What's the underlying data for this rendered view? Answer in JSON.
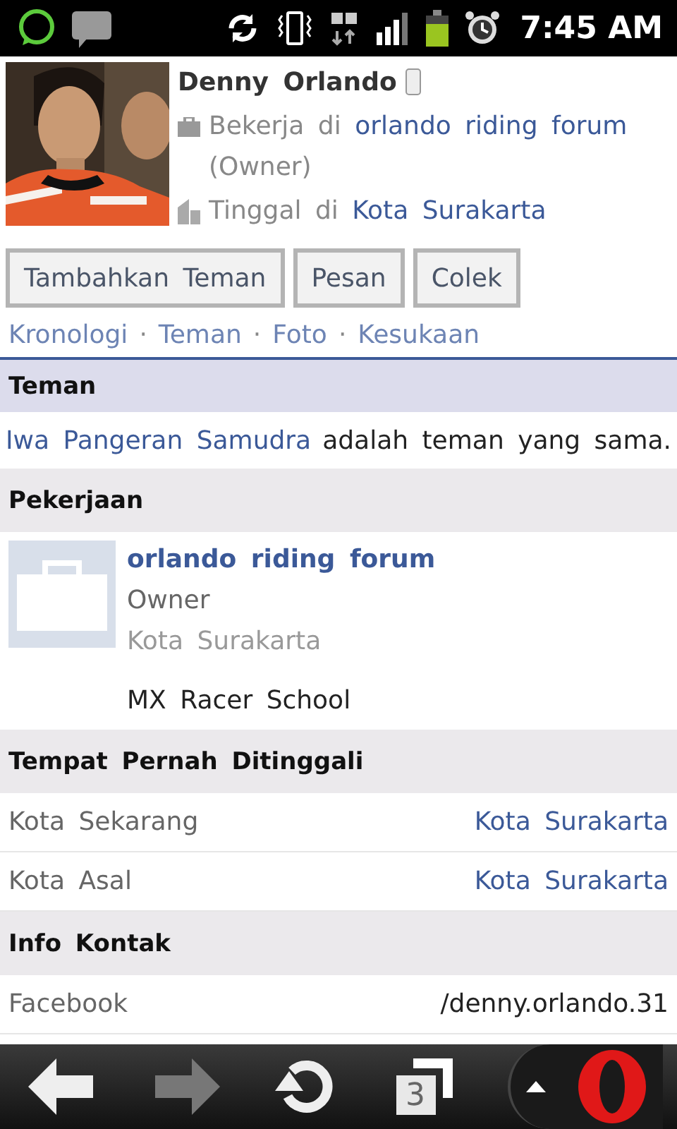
{
  "status_bar": {
    "time": "7:45 AM"
  },
  "profile": {
    "name": "Denny Orlando",
    "work_prefix": "Bekerja di",
    "work_link": "orlando riding forum",
    "work_role": "(Owner)",
    "home_prefix": "Tinggal di",
    "home_link": "Kota Surakarta"
  },
  "buttons": [
    "Tambahkan Teman",
    "Pesan",
    "Colek"
  ],
  "nav_links": [
    "Kronologi",
    "Teman",
    "Foto",
    "Kesukaan"
  ],
  "nav_separator": "·",
  "friends": {
    "title": "Teman",
    "friend": "Iwa Pangeran Samudra",
    "text": "adalah teman yang sama."
  },
  "work": {
    "title": "Pekerjaan",
    "company": "orlando riding forum",
    "role": "Owner",
    "location": "Kota Surakarta",
    "school": "MX Racer School"
  },
  "places": {
    "title": "Tempat Pernah Ditinggali",
    "rows": [
      {
        "label": "Kota Sekarang",
        "value": "Kota Surakarta"
      },
      {
        "label": "Kota Asal",
        "value": "Kota Surakarta"
      }
    ]
  },
  "contact": {
    "title": "Info Kontak",
    "rows": [
      {
        "label": "Facebook",
        "value": "/denny.orlando.31"
      }
    ]
  },
  "browser_bar": {
    "back_disabled": false,
    "forward_disabled": true,
    "tab_count": "3"
  }
}
